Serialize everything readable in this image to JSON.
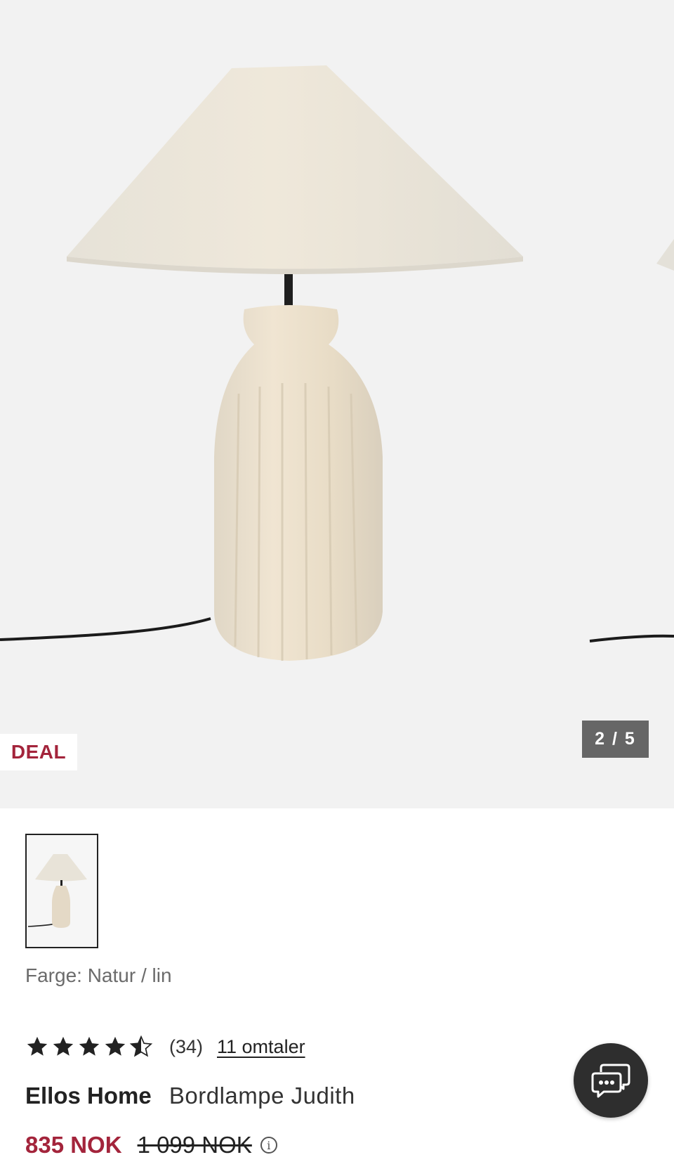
{
  "gallery": {
    "badge": "DEAL",
    "counter": "2 / 5",
    "background": "#f2f2f2"
  },
  "variant": {
    "color_label": "Farge: Natur / lin"
  },
  "rating": {
    "value": 4.5,
    "max": 5,
    "count": "(34)",
    "reviews_link": "11 omtaler"
  },
  "product": {
    "brand": "Ellos Home",
    "name": "Bordlampe Judith"
  },
  "price": {
    "current": "835 NOK",
    "original": "1 099 NOK",
    "info_icon": "info-icon"
  },
  "colors": {
    "deal_red": "#a3243b",
    "chat_bg": "#2e2e2e"
  },
  "icons": {
    "chat": "chat-bubbles-icon",
    "star": "star-icon"
  }
}
